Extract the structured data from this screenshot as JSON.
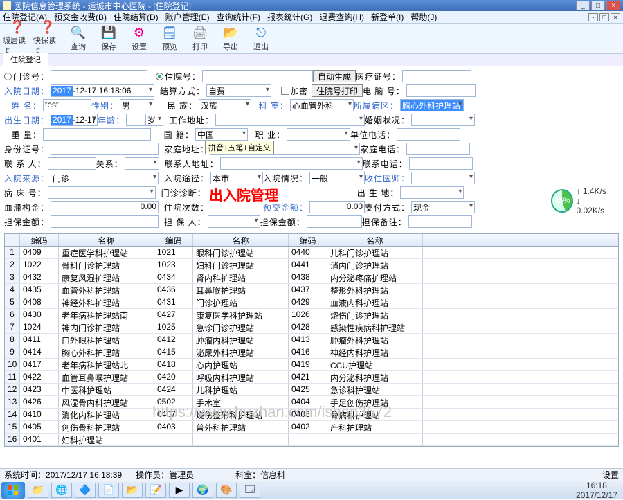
{
  "window": {
    "title": "医院信息管理系统  -  运城市中心医院 - [住院登记]",
    "min": "_",
    "max": "□",
    "close": "×"
  },
  "menu": [
    "住院登记(A)",
    "预交金收费(B)",
    "住院结算(D)",
    "账户管理(E)",
    "查询统计(F)",
    "报表统计(G)",
    "退费查询(H)",
    "新登单(I)",
    "帮助(J)"
  ],
  "mdi": {
    "min": "-",
    "max": "□",
    "close": "×"
  },
  "toolbar": [
    {
      "icon": "❓",
      "color": "#d43",
      "label": "城居读卡"
    },
    {
      "icon": "❓",
      "color": "#d43",
      "label": "快保读卡"
    },
    {
      "icon": "🔍",
      "color": "#2a7ed6",
      "label": "查询"
    },
    {
      "icon": "💾",
      "color": "#2a7ed6",
      "label": "保存"
    },
    {
      "icon": "⚙",
      "color": "#e08",
      "label": "设置"
    },
    {
      "icon": "🗒",
      "color": "#2a7ed6",
      "label": "预览"
    },
    {
      "icon": "🖨",
      "color": "#888",
      "label": "打印"
    },
    {
      "icon": "📂",
      "color": "#e6a500",
      "label": "导出"
    },
    {
      "icon": "⎋",
      "color": "#2a7ed6",
      "label": "退出"
    }
  ],
  "tab": "住院登记",
  "form": {
    "outpatient_no_label": "门诊号：",
    "outpatient_no": "",
    "inpatient_no_label": "住院号：",
    "inpatient_no": "",
    "auto_gen": "自动生成",
    "medcert_label": "医疗证号：",
    "admit_date_label": "入院日期：",
    "admit_date_prefix": "2017",
    "admit_date_rest": "-12-17 16:18:06",
    "settle_label": "结算方式：",
    "settle_value": "自费",
    "encrypt": "加密",
    "print_inpno": "住院号打印",
    "phone_label": "电  脑  号：",
    "name_label": "姓        名：",
    "name": "test",
    "gender_label": "性别：",
    "gender": "男",
    "nation_label": "民        族：",
    "nation": "汉族",
    "dept_label": "科        室：",
    "dept": "心血管外科",
    "ward_label": "所属病区：",
    "ward": "胸心外科护理站",
    "birth_label": "出生日期：",
    "birth_prefix": "2017",
    "birth_rest": "-12-17",
    "age_label": "年龄：",
    "age": "",
    "age_unit": "岁",
    "workaddr_label": "工作地址：",
    "marriage_label": "婚姻状况：",
    "weight_label": "重        量：",
    "country_label": "国        籍：",
    "country": "中国",
    "job_label": "职        业：",
    "unitphone_label": "单位电话：",
    "idcard_label": "身份证号：",
    "homeaddr_label": "家庭地址：",
    "homephone_label": "家庭电话：",
    "tooltip": "拼音+五笔+自定义",
    "contact_label": "联  系  人：",
    "relation_label": "关系：",
    "contactaddr_label": "联系人地址：",
    "contactphone_label": "联系电话：",
    "admitfrom_label": "入院来源：",
    "admitfrom": "门诊",
    "admitpath_label": "入院途径：",
    "admitpath": "本市",
    "admitcond_label": "入院情况：",
    "admitcond": "一般",
    "recvdr_label": "收住医师：",
    "bed_label": "病  床  号：",
    "outdiag_label": "门诊诊断：",
    "birthplace_label": "出  生  地：",
    "watermark": "出入院管理",
    "bloodcard_label": "血滞构金：",
    "bloodcard": "0.00",
    "intimes_label": "住院次数：",
    "prepay_label": "预交金额：",
    "prepay": "0.00",
    "paymode_label": "支付方式：",
    "paymode": "现金",
    "guarantee_label": "担保金额：",
    "guarantor_label": "担  保  人：",
    "guaranteeamt_label": "担保金额：",
    "guaranteenote_label": "担保备注："
  },
  "grid": {
    "headers": [
      "编码",
      "名称",
      "编码",
      "名称",
      "编码",
      "名称"
    ],
    "rows": [
      [
        "0409",
        "重症医学科护理站",
        "1021",
        "眼科门诊护理站",
        "0440",
        "儿科门诊护理站"
      ],
      [
        "1022",
        "骨科门诊护理站",
        "1023",
        "妇科门诊护理站",
        "0441",
        "消内门诊护理站"
      ],
      [
        "0432",
        "康复风湿护理站",
        "0434",
        "肾内科护理站",
        "0438",
        "内分泌疼痛护理站"
      ],
      [
        "0435",
        "血管外科护理站",
        "0436",
        "耳鼻喉护理站",
        "0437",
        "整形外科护理站"
      ],
      [
        "0408",
        "神经外科护理站",
        "0431",
        "门诊护理站",
        "0429",
        "血液内科护理站"
      ],
      [
        "0430",
        "老年病科护理站南",
        "0427",
        "康复医学科护理站",
        "1026",
        "烧伤门诊护理站"
      ],
      [
        "1024",
        "神内门诊护理站",
        "1025",
        "急诊门诊护理站",
        "0428",
        "感染性疾病科护理站"
      ],
      [
        "0411",
        "口外眼科护理站",
        "0412",
        "肿瘤内科护理站",
        "0413",
        "肿瘤外科护理站"
      ],
      [
        "0414",
        "胸心外科护理站",
        "0415",
        "泌尿外科护理站",
        "0416",
        "神经内科护理站"
      ],
      [
        "0417",
        "老年病科护理站北",
        "0418",
        "心内护理站",
        "0419",
        "CCU护理站"
      ],
      [
        "0422",
        "血管耳鼻喉护理站",
        "0420",
        "呼吸内科护理站",
        "0421",
        "内分泌科护理站"
      ],
      [
        "0423",
        "中医科护理站",
        "0424",
        "儿科护理站",
        "0425",
        "急诊科护理站"
      ],
      [
        "0426",
        "风湿骨内科护理站",
        "0502",
        "手术室",
        "0404",
        "手足创伤护理站"
      ],
      [
        "0410",
        "消化内科护理站",
        "0407",
        "烧伤整形科护理站",
        "0406",
        "骨病科护理站"
      ],
      [
        "0405",
        "创伤骨科护理站",
        "0403",
        "普外科护理站",
        "0402",
        "产科护理站"
      ],
      [
        "0401",
        "妇科护理站",
        "",
        "",
        "",
        ""
      ]
    ]
  },
  "status": {
    "time_label": "系统时间：",
    "time": "2017/12/17 16:18:39",
    "op_label": "操作员：",
    "op": "管理员",
    "dept_label": "科室：",
    "dept": "信息科",
    "settings": "设置"
  },
  "tray": {
    "time": "16:18",
    "date": "2017/12/17"
  },
  "gauge": {
    "pct": "45%",
    "l1": "1.4K/s",
    "l2": "0.02K/s"
  },
  "wm_url": "https://www.huzhan.com/ishop3572"
}
